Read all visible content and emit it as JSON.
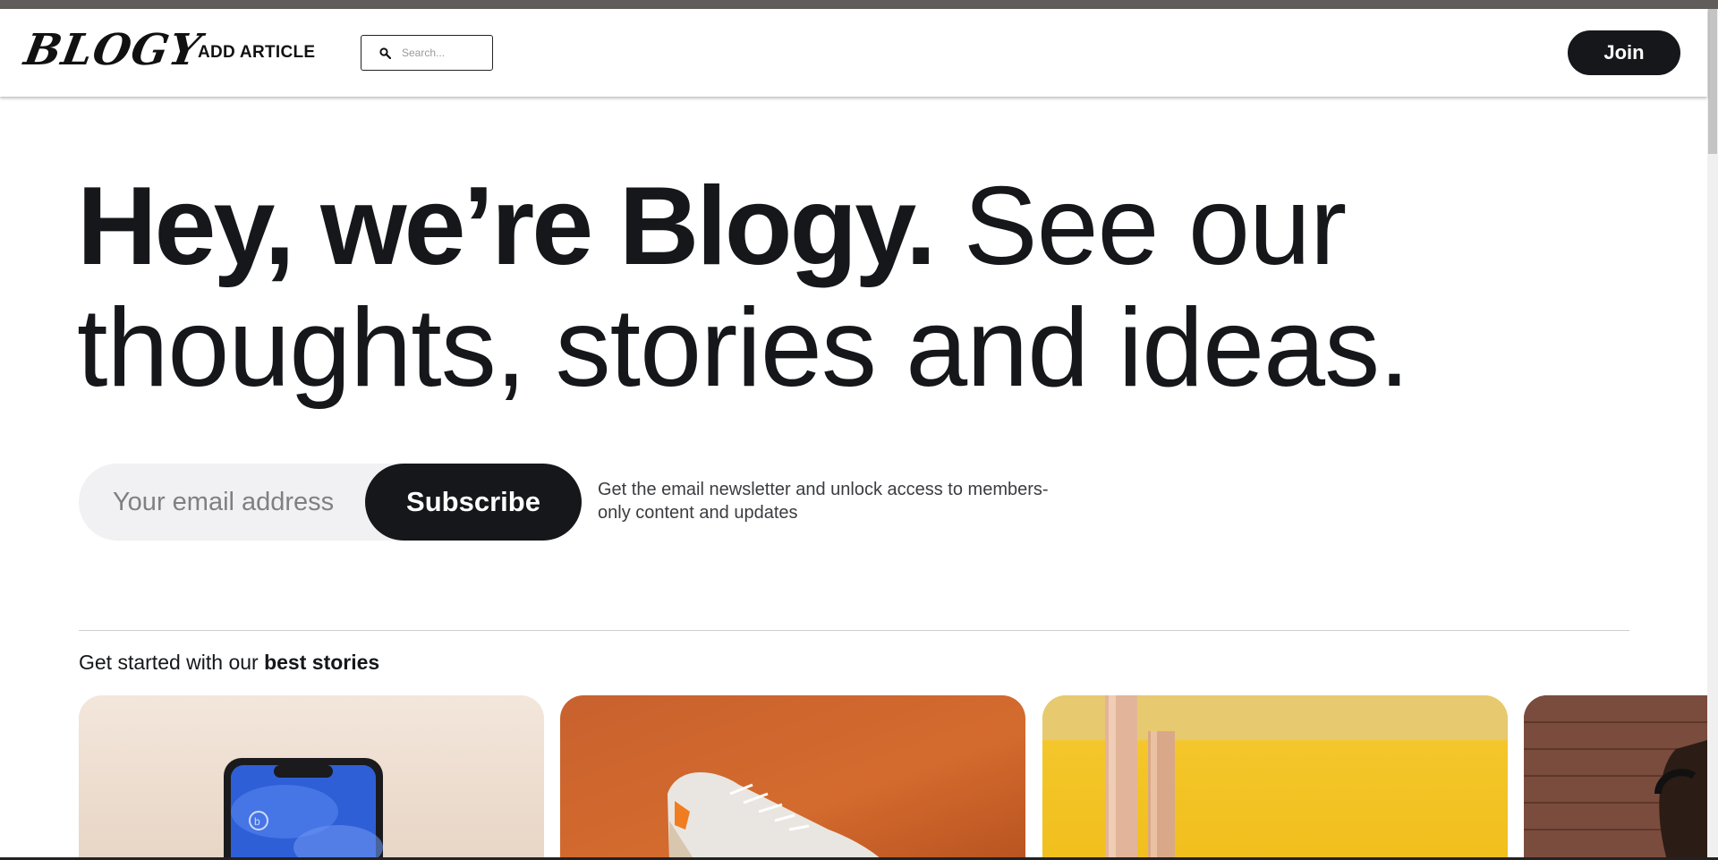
{
  "header": {
    "logo": "BLOGY",
    "add_article": "ADD ARTICLE",
    "search_placeholder": "Search...",
    "join_label": "Join"
  },
  "hero": {
    "bold_text": "Hey, we’re Blogy.",
    "light_text": "See our thoughts, stories and ideas."
  },
  "subscribe": {
    "email_placeholder": "Your email address",
    "button_label": "Subscribe",
    "note": "Get the email newsletter and unlock access to members-only content and updates"
  },
  "best_stories": {
    "heading_prefix": "Get started with our",
    "heading_bold": "best stories",
    "cards": [
      {
        "image": "phone-image"
      },
      {
        "image": "sneaker-image"
      },
      {
        "image": "yellow-chair-image"
      },
      {
        "image": "brick-wall-person-image"
      }
    ]
  },
  "colors": {
    "primary": "#15171a",
    "input_bg": "#f1f0f2",
    "card_orange": "#d46b2e",
    "card_yellow": "#f4c62a"
  }
}
